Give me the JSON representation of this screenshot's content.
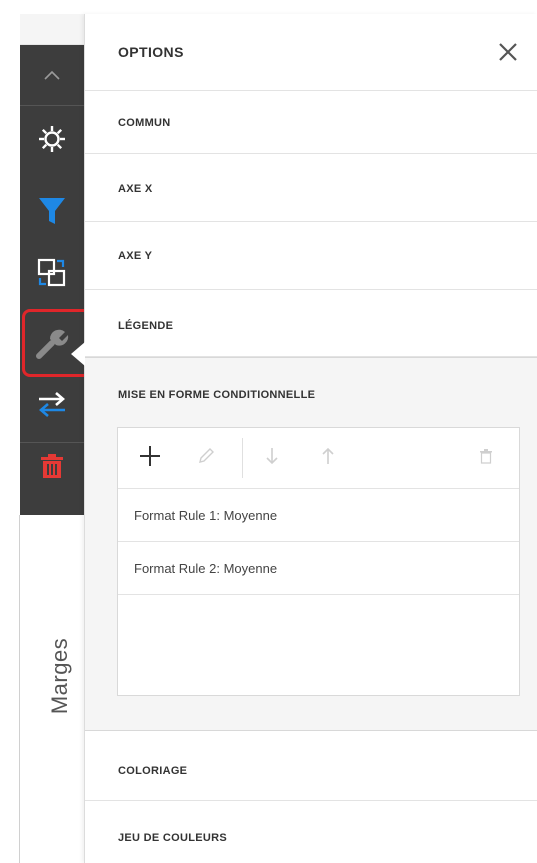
{
  "panel": {
    "title": "OPTIONS",
    "sections": [
      {
        "label": "COMMUN"
      },
      {
        "label": "AXE X"
      },
      {
        "label": "AXE Y"
      },
      {
        "label": "LÉGENDE"
      },
      {
        "label": "MISE EN FORME CONDITIONNELLE"
      },
      {
        "label": "COLORIAGE"
      },
      {
        "label": "JEU DE COULEURS"
      }
    ]
  },
  "rules": {
    "items": [
      {
        "label": "Format Rule 1: Moyenne"
      },
      {
        "label": "Format Rule 2: Moyenne"
      }
    ]
  },
  "background": {
    "side_label": "Marges"
  },
  "toolbar": {
    "icons": [
      "chevron-up-icon",
      "gear-icon",
      "filter-icon",
      "convert-icon",
      "wrench-icon",
      "swap-icon",
      "trash-icon"
    ]
  },
  "colors": {
    "toolbar_bg": "#3d3d3d",
    "accent_blue": "#1e88e5",
    "delete_red": "#e53935",
    "highlight_red": "#e0262a"
  }
}
